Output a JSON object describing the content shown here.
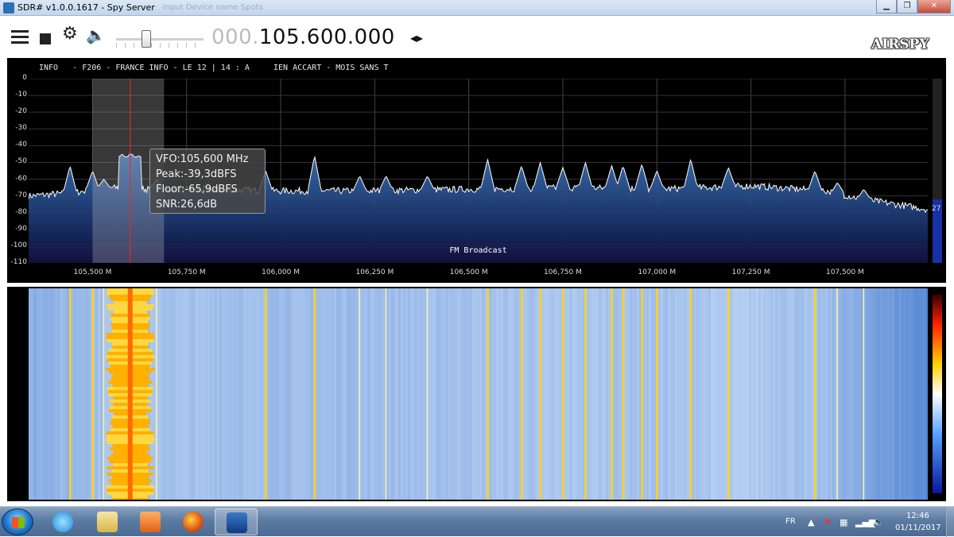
{
  "window": {
    "title": "SDR# v1.0.0.1617 - Spy Server",
    "ghost_text": "Input   Device name   Spots",
    "minimize": "▁",
    "maximize": "❐",
    "close": "✕"
  },
  "toolbar": {
    "freq_dim": "000.",
    "freq_main": "105.600.000",
    "freq_arrows": "◂▸",
    "logo": "AIRSPY"
  },
  "spectrum": {
    "rds_info_label": "INFO",
    "rds_text": "- F206 - FRANCE INFO - LE 12 | 14 : A     IEN ACCART - MOIS SANS T",
    "y_ticks": [
      "0",
      "-10",
      "-20",
      "-30",
      "-40",
      "-50",
      "-60",
      "-70",
      "-80",
      "-90",
      "-100",
      "-110"
    ],
    "x_ticks": [
      "105,500 M",
      "105,750 M",
      "106,000 M",
      "106,250 M",
      "106,500 M",
      "106,750 M",
      "107,000 M",
      "107,250 M",
      "107,500 M"
    ],
    "band_label": "FM Broadcast",
    "level_value": "27",
    "tooltip": {
      "vfo": "VFO:105,600 MHz",
      "peak": "Peak:-39,3dBFS",
      "floor": "Floor:-65,9dBFS",
      "snr": "SNR:26,6dB"
    },
    "colors": {
      "fill_top": "#3a6fb0",
      "fill_bottom": "#081040",
      "trace": "#ffffff",
      "band": "#b00010",
      "vfo_line": "#ff2020"
    }
  },
  "chart_data": {
    "type": "area",
    "xlabel": "",
    "ylabel": "",
    "x_unit": "MHz",
    "y_unit": "dBFS",
    "xlim": [
      105.33,
      107.72
    ],
    "ylim": [
      -110,
      0
    ],
    "grid": true,
    "noise_floor": [
      [
        105.33,
        -70
      ],
      [
        105.45,
        -68
      ],
      [
        105.55,
        -65
      ],
      [
        105.65,
        -66
      ],
      [
        105.8,
        -66
      ],
      [
        106.0,
        -67
      ],
      [
        106.2,
        -67
      ],
      [
        106.5,
        -66
      ],
      [
        106.8,
        -65
      ],
      [
        107.0,
        -66
      ],
      [
        107.25,
        -64
      ],
      [
        107.45,
        -67
      ],
      [
        107.55,
        -72
      ],
      [
        107.72,
        -78
      ]
    ],
    "peaks": [
      [
        105.44,
        -52
      ],
      [
        105.5,
        -55
      ],
      [
        105.53,
        -60
      ],
      [
        105.6,
        -44
      ],
      [
        105.67,
        -60
      ],
      [
        105.96,
        -55
      ],
      [
        106.09,
        -46
      ],
      [
        106.21,
        -58
      ],
      [
        106.28,
        -58
      ],
      [
        106.39,
        -58
      ],
      [
        106.55,
        -48
      ],
      [
        106.64,
        -52
      ],
      [
        106.69,
        -50
      ],
      [
        106.75,
        -53
      ],
      [
        106.81,
        -50
      ],
      [
        106.88,
        -52
      ],
      [
        106.91,
        -52
      ],
      [
        106.96,
        -51
      ],
      [
        107.0,
        -55
      ],
      [
        107.09,
        -48
      ],
      [
        107.19,
        -53
      ],
      [
        107.42,
        -55
      ],
      [
        107.48,
        -62
      ],
      [
        107.55,
        -66
      ]
    ],
    "vfo_mhz": 105.6,
    "filter_mhz": [
      105.5,
      105.69
    ],
    "band_dbfs": [
      -98,
      -110
    ]
  }
}
